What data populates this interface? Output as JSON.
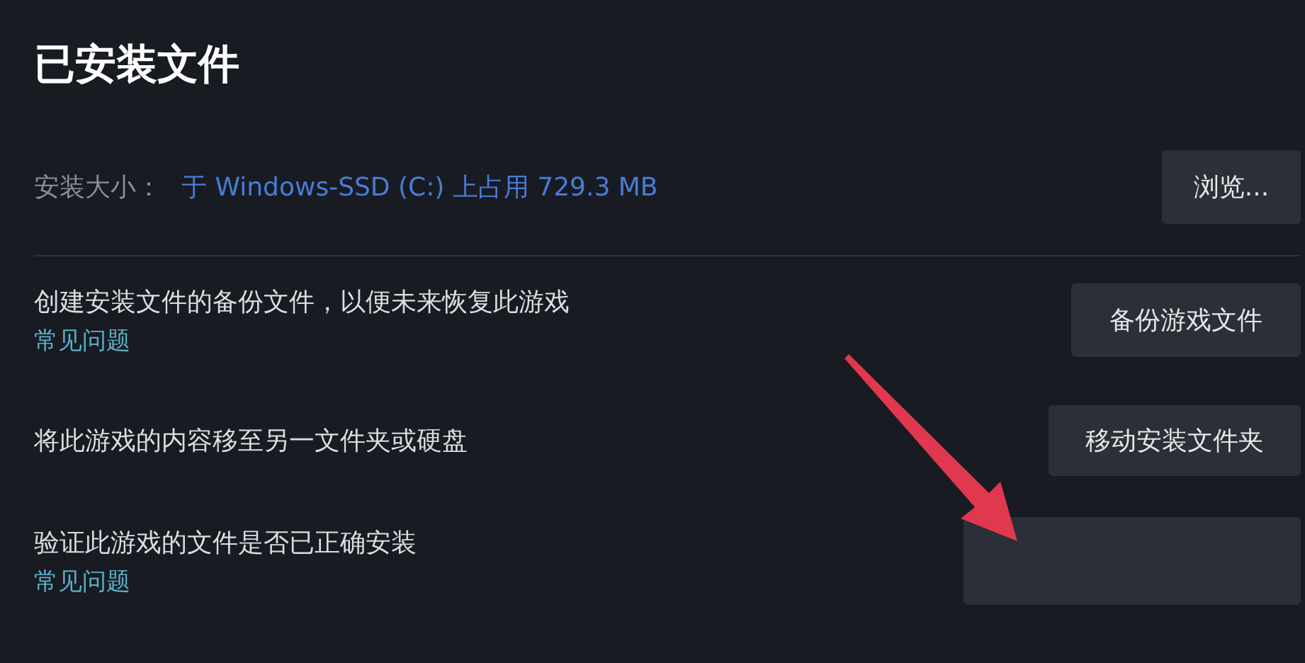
{
  "title": "已安装文件",
  "install_size": {
    "label": "安装大小：",
    "value": "于 Windows-SSD (C:) 上占用 729.3 MB",
    "button": "浏览..."
  },
  "actions": [
    {
      "description": "创建安装文件的备份文件，以便未来恢复此游戏",
      "link": "常见问题",
      "button": "备份游戏文件"
    },
    {
      "description": "将此游戏的内容移至另一文件夹或硬盘",
      "button": "移动安装文件夹"
    },
    {
      "description": "验证此游戏的文件是否已正确安装",
      "link": "常见问题"
    }
  ]
}
